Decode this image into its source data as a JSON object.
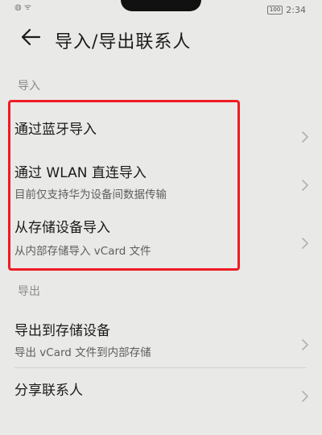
{
  "status_bar": {
    "left_icons": "◍ ᯤ",
    "battery": "100",
    "time": "2:34"
  },
  "header": {
    "title": "导入/导出联系人"
  },
  "sections": {
    "import": {
      "label": "导入",
      "items": [
        {
          "title": "通过蓝牙导入",
          "subtitle": ""
        },
        {
          "title": "通过 WLAN 直连导入",
          "subtitle": "目前仅支持华为设备间数据传输"
        },
        {
          "title": "从存储设备导入",
          "subtitle": "从内部存储导入 vCard 文件"
        }
      ]
    },
    "export": {
      "label": "导出",
      "items": [
        {
          "title": "导出到存储设备",
          "subtitle": "导出 vCard 文件到内部存储"
        },
        {
          "title": "分享联系人",
          "subtitle": ""
        }
      ]
    }
  },
  "colors": {
    "background": "#e9e9e7",
    "highlight": "#ee1c24",
    "text_primary": "#1b1b1b",
    "text_secondary": "#5e5e5e",
    "section_label": "#8a8a8a"
  },
  "icons": {
    "back": "back-arrow-icon",
    "chevron": "chevron-right-icon"
  }
}
